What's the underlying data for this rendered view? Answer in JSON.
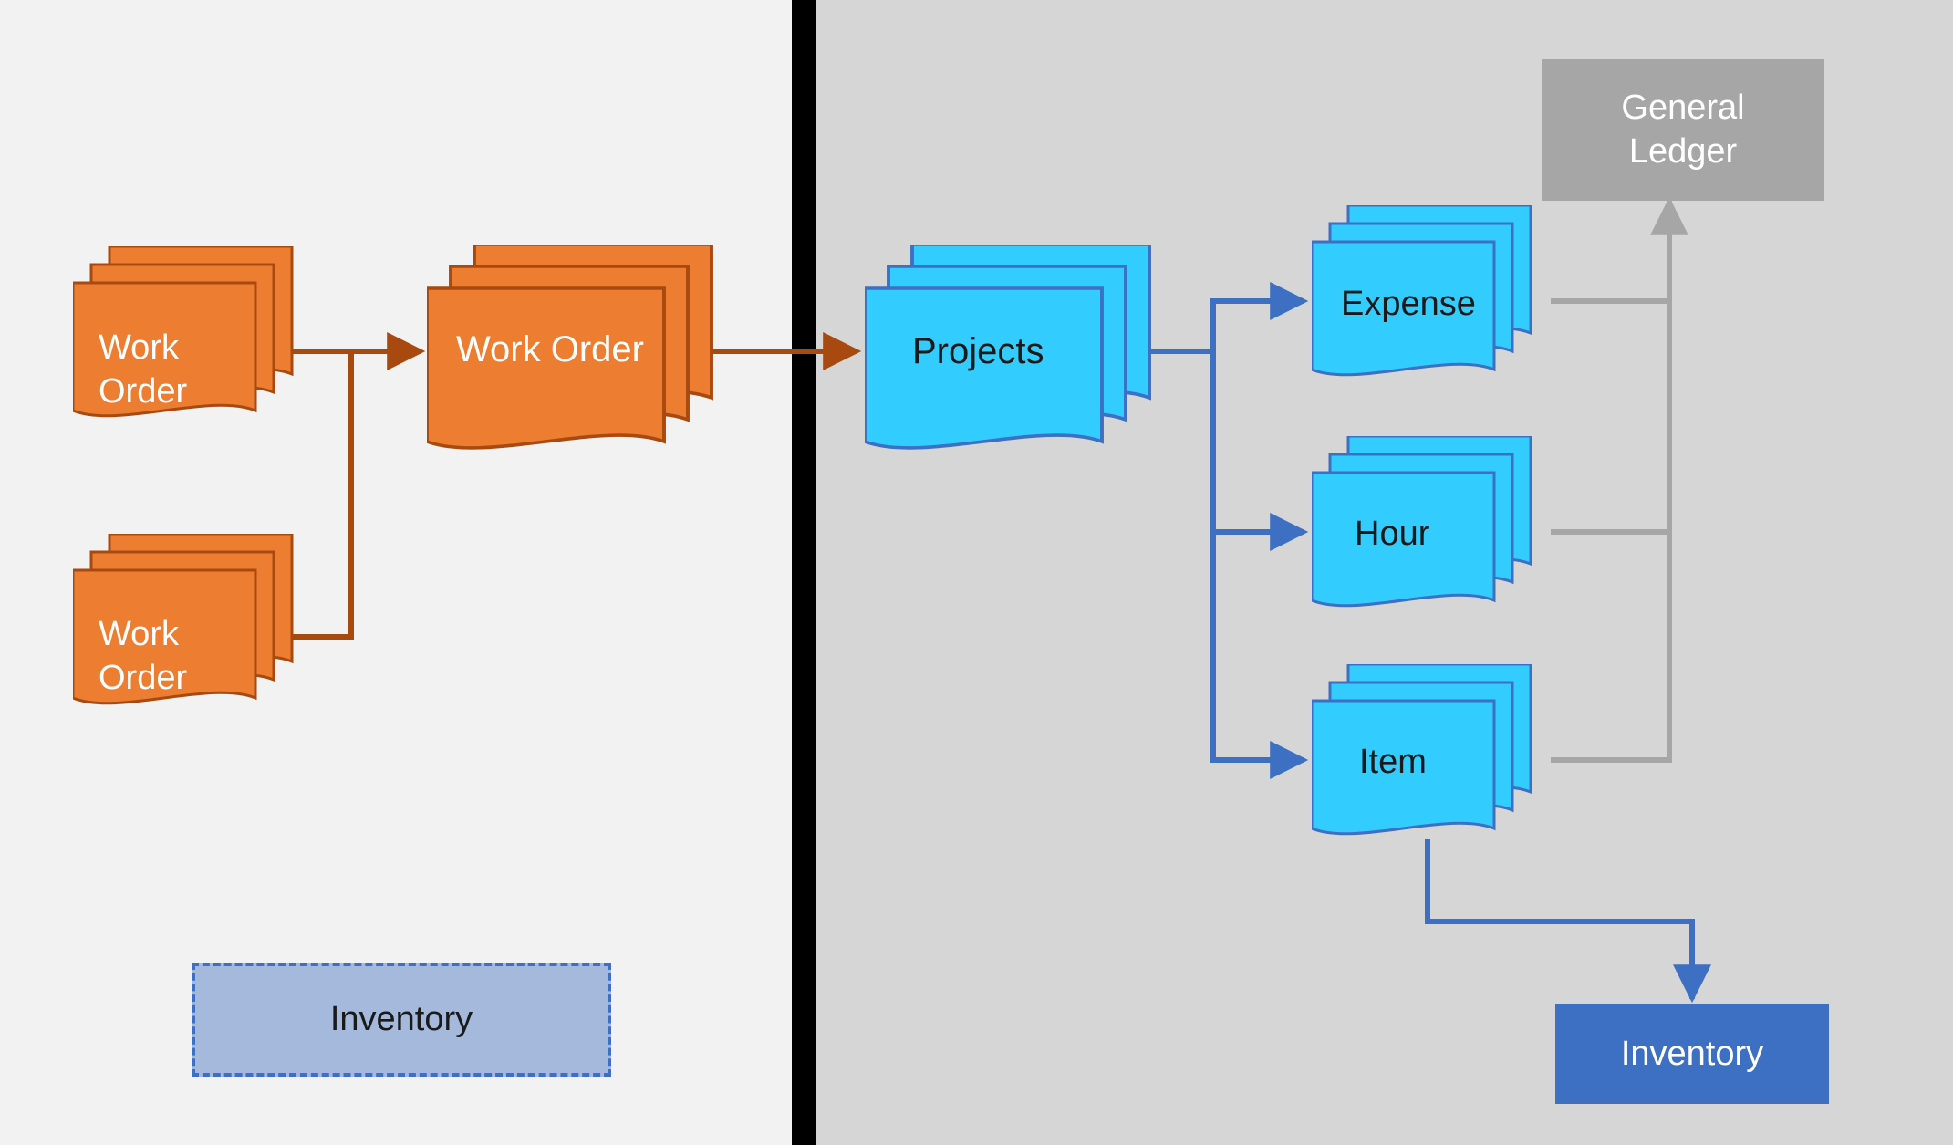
{
  "nodes": {
    "work_order_1": "Work\nOrder",
    "work_order_2": "Work\nOrder",
    "work_order_main": "Work Order",
    "projects": "Projects",
    "expense": "Expense",
    "hour": "Hour",
    "item": "Item",
    "general_ledger": "General\nLedger",
    "inventory_left": "Inventory",
    "inventory_right": "Inventory"
  },
  "colors": {
    "orange_fill": "#ed7d31",
    "orange_stroke": "#a84a10",
    "cyan_fill": "#33ccff",
    "blue_stroke": "#3d6fc3",
    "grey_box": "#a6a6a6",
    "grey_line": "#a6a6a6",
    "blue_box": "#3d6fc3",
    "dashed_fill": "#a4b9dc",
    "panel_left": "#f2f2f2",
    "panel_right": "#d6d6d6",
    "divider": "#000000"
  },
  "edges": [
    {
      "from": "work_order_1",
      "to": "work_order_main",
      "style": "orange"
    },
    {
      "from": "work_order_2",
      "to": "work_order_main",
      "style": "orange"
    },
    {
      "from": "work_order_main",
      "to": "projects",
      "style": "orange"
    },
    {
      "from": "projects",
      "to": "expense",
      "style": "blue"
    },
    {
      "from": "projects",
      "to": "hour",
      "style": "blue"
    },
    {
      "from": "projects",
      "to": "item",
      "style": "blue"
    },
    {
      "from": "expense",
      "to": "general_ledger",
      "style": "grey"
    },
    {
      "from": "hour",
      "to": "general_ledger",
      "style": "grey"
    },
    {
      "from": "item",
      "to": "general_ledger",
      "style": "grey"
    },
    {
      "from": "item",
      "to": "inventory_right",
      "style": "blue"
    }
  ]
}
